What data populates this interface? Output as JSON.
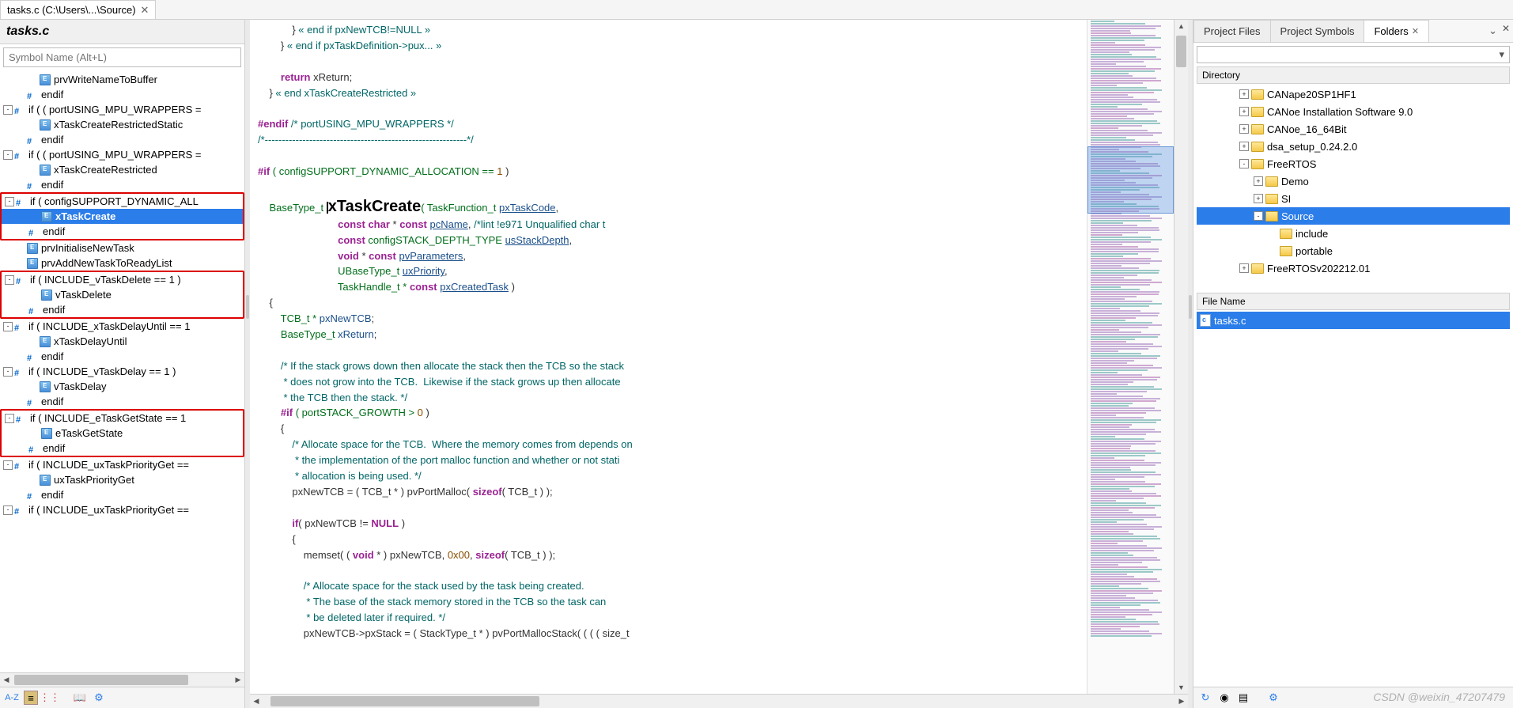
{
  "file_tab": {
    "label": "tasks.c (C:\\Users\\...\\Source)"
  },
  "left": {
    "title": "tasks.c",
    "search_placeholder": "Symbol Name (Alt+L)",
    "items": [
      {
        "indent": 2,
        "icon": "func",
        "label": "prvWriteNameToBuffer"
      },
      {
        "indent": 1,
        "icon": "pound",
        "label": "endif"
      },
      {
        "indent": 0,
        "expander": "-",
        "icon": "pound",
        "label": "if ( ( portUSING_MPU_WRAPPERS ="
      },
      {
        "indent": 2,
        "icon": "func",
        "label": "xTaskCreateRestrictedStatic"
      },
      {
        "indent": 1,
        "icon": "pound",
        "label": "endif"
      },
      {
        "indent": 0,
        "expander": "-",
        "icon": "pound",
        "label": "if ( ( portUSING_MPU_WRAPPERS ="
      },
      {
        "indent": 2,
        "icon": "func",
        "label": "xTaskCreateRestricted"
      },
      {
        "indent": 1,
        "icon": "pound",
        "label": "endif"
      },
      {
        "indent": 0,
        "expander": "-",
        "icon": "pound",
        "label": "if ( configSUPPORT_DYNAMIC_ALL",
        "redbox": true
      },
      {
        "indent": 2,
        "icon": "func",
        "label": "xTaskCreate",
        "selected": true,
        "redbox": true
      },
      {
        "indent": 1,
        "icon": "pound",
        "label": "endif",
        "redbox": true
      },
      {
        "indent": 1,
        "icon": "func",
        "label": "prvInitialiseNewTask"
      },
      {
        "indent": 1,
        "icon": "func",
        "label": "prvAddNewTaskToReadyList"
      },
      {
        "indent": 0,
        "expander": "-",
        "icon": "pound",
        "label": "if ( INCLUDE_vTaskDelete == 1 )",
        "redbox": true
      },
      {
        "indent": 2,
        "icon": "func",
        "label": "vTaskDelete",
        "redbox": true
      },
      {
        "indent": 1,
        "icon": "pound",
        "label": "endif",
        "redbox": true
      },
      {
        "indent": 0,
        "expander": "-",
        "icon": "pound",
        "label": "if ( INCLUDE_xTaskDelayUntil == 1"
      },
      {
        "indent": 2,
        "icon": "func",
        "label": "xTaskDelayUntil"
      },
      {
        "indent": 1,
        "icon": "pound",
        "label": "endif"
      },
      {
        "indent": 0,
        "expander": "-",
        "icon": "pound",
        "label": "if ( INCLUDE_vTaskDelay == 1 )"
      },
      {
        "indent": 2,
        "icon": "func",
        "label": "vTaskDelay"
      },
      {
        "indent": 1,
        "icon": "pound",
        "label": "endif"
      },
      {
        "indent": 0,
        "expander": "-",
        "icon": "pound",
        "label": "if ( INCLUDE_eTaskGetState == 1",
        "redbox": true
      },
      {
        "indent": 2,
        "icon": "func",
        "label": "eTaskGetState",
        "redbox": true
      },
      {
        "indent": 1,
        "icon": "pound",
        "label": "endif",
        "redbox": true
      },
      {
        "indent": 0,
        "expander": "-",
        "icon": "pound",
        "label": "if ( INCLUDE_uxTaskPriorityGet =="
      },
      {
        "indent": 2,
        "icon": "func",
        "label": "uxTaskPriorityGet"
      },
      {
        "indent": 1,
        "icon": "pound",
        "label": "endif"
      },
      {
        "indent": 0,
        "expander": "-",
        "icon": "pound",
        "label": "if ( INCLUDE_uxTaskPriorityGet =="
      }
    ]
  },
  "code": {
    "l1a": "            } ",
    "l1b": "« end if pxNewTCB!=NULL »",
    "l2a": "        } ",
    "l2b": "« end if pxTaskDefinition->pux... »",
    "l3": "",
    "l4a": "        ",
    "l4b": "return",
    "l4c": " xReturn;",
    "l5a": "    } ",
    "l5b": "« end xTaskCreateRestricted »",
    "l6": "",
    "l7a": "#endif",
    "l7b": " /* portUSING_MPU_WRAPPERS */",
    "l8": "/*-----------------------------------------------------------*/",
    "l9": "",
    "l10a": "#if",
    "l10b": " ( configSUPPORT_DYNAMIC_ALLOCATION == ",
    "l10c": "1",
    "l10d": " )",
    "l11": "",
    "l12a": "    BaseType_t ",
    "l12b": "xTaskCreate",
    "l12c": "( TaskFunction_t ",
    "l12d": "pxTaskCode",
    "l12e": ",",
    "l13a": "                            ",
    "l13b": "const",
    "l13c": " ",
    "l13d": "char",
    "l13e": " * ",
    "l13f": "const",
    "l13g": " ",
    "l13h": "pcName",
    "l13i": ", ",
    "l13j": "/*lint !e971 Unqualified char t",
    "l14a": "                            ",
    "l14b": "const",
    "l14c": " configSTACK_DEPTH_TYPE ",
    "l14d": "usStackDepth",
    "l14e": ",",
    "l15a": "                            ",
    "l15b": "void",
    "l15c": " * ",
    "l15d": "const",
    "l15e": " ",
    "l15f": "pvParameters",
    "l15g": ",",
    "l16a": "                            UBaseType_t ",
    "l16b": "uxPriority",
    "l16c": ",",
    "l17a": "                            TaskHandle_t * ",
    "l17b": "const",
    "l17c": " ",
    "l17d": "pxCreatedTask",
    "l17e": " )",
    "l18": "    {",
    "l19a": "        TCB_t * ",
    "l19b": "pxNewTCB",
    "l19c": ";",
    "l20a": "        BaseType_t ",
    "l20b": "xReturn",
    "l20c": ";",
    "l21": "",
    "l22": "        /* If the stack grows down then allocate the stack then the TCB so the stack",
    "l23": "         * does not grow into the TCB.  Likewise if the stack grows up then allocate",
    "l24": "         * the TCB then the stack. */",
    "l25a": "        ",
    "l25b": "#if",
    "l25c": " ( portSTACK_GROWTH > ",
    "l25d": "0",
    "l25e": " )",
    "l26": "        {",
    "l27": "            /* Allocate space for the TCB.  Where the memory comes from depends on",
    "l28": "             * the implementation of the port malloc function and whether or not stati",
    "l29": "             * allocation is being used. */",
    "l30a": "            pxNewTCB = ( TCB_t * ) pvPortMalloc( ",
    "l30b": "sizeof",
    "l30c": "( TCB_t ) );",
    "l31": "",
    "l32a": "            ",
    "l32b": "if",
    "l32c": "( pxNewTCB != ",
    "l32d": "NULL",
    "l32e": " )",
    "l33": "            {",
    "l34a": "                memset( ( ",
    "l34b": "void",
    "l34c": " * ) pxNewTCB, ",
    "l34d": "0x00",
    "l34e": ", ",
    "l34f": "sizeof",
    "l34g": "( TCB_t ) );",
    "l35": "",
    "l36": "                /* Allocate space for the stack used by the task being created.",
    "l37": "                 * The base of the stack memory stored in the TCB so the task can",
    "l38": "                 * be deleted later if required. */",
    "l39a": "                pxNewTCB->pxStack = ( StackType_t * ) pvPortMallocStack( ( ( ( size_t"
  },
  "right": {
    "tabs": [
      {
        "label": "Project Files",
        "active": false
      },
      {
        "label": "Project Symbols",
        "active": false
      },
      {
        "label": "Folders",
        "active": true,
        "closeable": true
      }
    ],
    "dir_header": "Directory",
    "tree": [
      {
        "indent": 3,
        "expander": "+",
        "label": "CANape20SP1HF1"
      },
      {
        "indent": 3,
        "expander": "+",
        "label": "CANoe Installation Software 9.0"
      },
      {
        "indent": 3,
        "expander": "+",
        "label": "CANoe_16_64Bit"
      },
      {
        "indent": 3,
        "expander": "+",
        "label": "dsa_setup_0.24.2.0"
      },
      {
        "indent": 3,
        "expander": "-",
        "label": "FreeRTOS"
      },
      {
        "indent": 4,
        "expander": "+",
        "label": "Demo"
      },
      {
        "indent": 4,
        "expander": "+",
        "label": "SI"
      },
      {
        "indent": 4,
        "expander": "-",
        "label": "Source",
        "selected": true
      },
      {
        "indent": 5,
        "expander": "",
        "label": "include"
      },
      {
        "indent": 5,
        "expander": "",
        "label": "portable"
      },
      {
        "indent": 3,
        "expander": "+",
        "label": "FreeRTOSv202212.01"
      }
    ],
    "file_header": "File Name",
    "files": [
      {
        "label": "tasks.c",
        "selected": true
      }
    ]
  },
  "watermark": "CSDN @weixin_47207479"
}
